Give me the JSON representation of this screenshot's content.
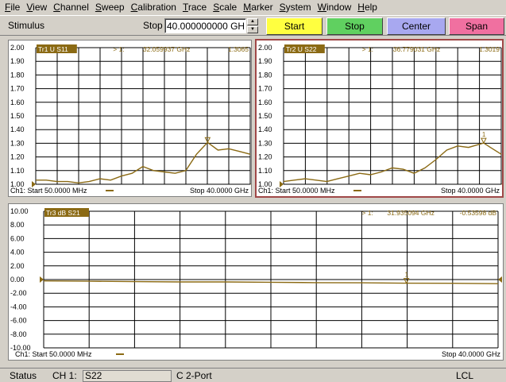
{
  "menu": [
    "File",
    "View",
    "Channel",
    "Sweep",
    "Calibration",
    "Trace",
    "Scale",
    "Marker",
    "System",
    "Window",
    "Help"
  ],
  "toolbar": {
    "stimulus_label": "Stimulus",
    "stop_label": "Stop",
    "stop_value": "40.000000000 GHz",
    "start_btn": "Start",
    "stop_btn": "Stop",
    "center_btn": "Center",
    "span_btn": "Span"
  },
  "colors": {
    "trace": "#8b6a14",
    "grid": "#000000",
    "active_border": "#a04848"
  },
  "charts": [
    {
      "trace_label": "Tr1 U S11",
      "marker_label": "> 1:",
      "marker_freq": "32.059937 GHz",
      "marker_value": "1.3065",
      "footer_start": "Ch1: Start  50.0000 MHz",
      "footer_stop": "Stop  40.0000 GHz",
      "yticks": [
        "2.00",
        "1.90",
        "1.80",
        "1.70",
        "1.60",
        "1.50",
        "1.40",
        "1.30",
        "1.20",
        "1.10",
        "1.00"
      ]
    },
    {
      "trace_label": "Tr2 U S22",
      "marker_label": "> 1:",
      "marker_freq": "36.779031 GHz",
      "marker_value": "1.3019",
      "marker_num": "1",
      "footer_start": "Ch1: Start  50.0000 MHz",
      "footer_stop": "Stop  40.0000 GHz",
      "yticks": [
        "2.00",
        "1.90",
        "1.80",
        "1.70",
        "1.60",
        "1.50",
        "1.40",
        "1.30",
        "1.20",
        "1.10",
        "1.00"
      ]
    },
    {
      "trace_label": "Tr3 dB S21",
      "marker_label": "> 1:",
      "marker_freq": "31.935094 GHz",
      "marker_value": "-0.53598 dB",
      "marker_num": "1",
      "footer_start": "Ch1: Start  50.0000 MHz",
      "footer_stop": "Stop  40.0000 GHz",
      "yticks": [
        "10.00",
        "8.00",
        "6.00",
        "4.00",
        "2.00",
        "0.00",
        "-2.00",
        "-4.00",
        "-6.00",
        "-8.00",
        "-10.00"
      ]
    }
  ],
  "chart_data": [
    {
      "type": "line",
      "ylim": [
        1.0,
        2.0
      ],
      "xlim": [
        0.05,
        40
      ],
      "series": [
        {
          "x": [
            0.05,
            2,
            4,
            6,
            8,
            10,
            12,
            14,
            16,
            18,
            20,
            22,
            24,
            26,
            28,
            30,
            32.06,
            34,
            36,
            38,
            40
          ],
          "y": [
            1.03,
            1.03,
            1.02,
            1.02,
            1.01,
            1.02,
            1.04,
            1.03,
            1.06,
            1.08,
            1.13,
            1.1,
            1.09,
            1.08,
            1.1,
            1.22,
            1.3065,
            1.25,
            1.26,
            1.24,
            1.22
          ]
        }
      ]
    },
    {
      "type": "line",
      "ylim": [
        1.0,
        2.0
      ],
      "xlim": [
        0.05,
        40
      ],
      "series": [
        {
          "x": [
            0.05,
            2,
            4,
            6,
            8,
            10,
            12,
            14,
            16,
            18,
            20,
            22,
            24,
            26,
            28,
            30,
            32,
            34,
            36.78,
            38,
            40
          ],
          "y": [
            1.02,
            1.03,
            1.04,
            1.03,
            1.02,
            1.04,
            1.06,
            1.08,
            1.07,
            1.09,
            1.12,
            1.11,
            1.08,
            1.12,
            1.18,
            1.25,
            1.28,
            1.27,
            1.3019,
            1.27,
            1.22
          ]
        }
      ]
    },
    {
      "type": "line",
      "ylim": [
        -10,
        10
      ],
      "xlim": [
        0.05,
        40
      ],
      "series": [
        {
          "x": [
            0.05,
            4,
            8,
            12,
            16,
            20,
            24,
            28,
            31.94,
            36,
            40
          ],
          "y": [
            -0.2,
            -0.25,
            -0.3,
            -0.35,
            -0.35,
            -0.4,
            -0.45,
            -0.48,
            -0.536,
            -0.55,
            -0.6
          ]
        }
      ]
    }
  ],
  "status": {
    "status_label": "Status",
    "channel_label": "CH 1:",
    "channel_value": "S22",
    "mode": "C  2-Port",
    "lcl": "LCL"
  }
}
